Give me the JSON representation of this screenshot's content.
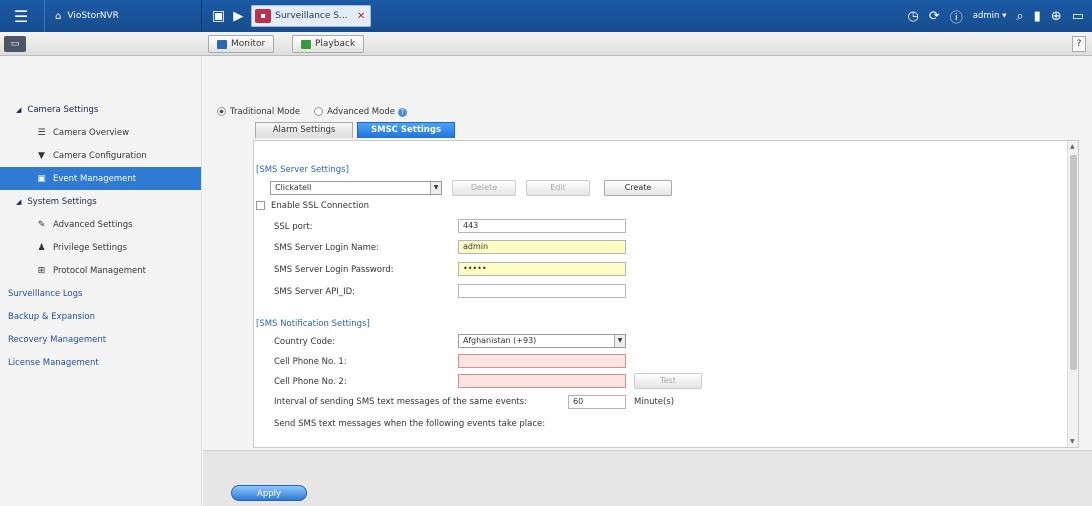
{
  "topbar": {
    "brand": "VioStorNVR",
    "app_tab": "Surveillance S...",
    "user": "admin"
  },
  "toolbar": {
    "monitor": "Monitor",
    "playback": "Playback",
    "help": "?"
  },
  "sidebar": {
    "camera_settings": "Camera Settings",
    "camera_overview": "Camera Overview",
    "camera_configuration": "Camera Configuration",
    "event_management": "Event Management",
    "system_settings": "System Settings",
    "advanced_settings": "Advanced Settings",
    "privilege_settings": "Privilege Settings",
    "protocol_management": "Protocol Management",
    "surveillance_logs": "Surveillance Logs",
    "backup_expansion": "Backup & Expansion",
    "recovery_management": "Recovery Management",
    "license_management": "License Management"
  },
  "modes": {
    "traditional": "Traditional Mode",
    "advanced": "Advanced Mode"
  },
  "tabs": {
    "alarm": "Alarm Settings",
    "smsc": "SMSC Settings"
  },
  "sms_server": {
    "section": "[SMS Server Settings]",
    "provider": "Clickatell",
    "delete": "Delete",
    "edit": "Edit",
    "create": "Create",
    "ssl_label": "Enable SSL Connection",
    "ssl_port_label": "SSL port:",
    "ssl_port": "443",
    "login_name_label": "SMS Server Login Name:",
    "login_name": "admin",
    "login_password_label": "SMS Server Login Password:",
    "login_password": "•••••",
    "api_id_label": "SMS Server API_ID:",
    "api_id": ""
  },
  "notification": {
    "section": "[SMS Notification Settings]",
    "country_label": "Country Code:",
    "country": "Afghanistan (+93)",
    "phone1_label": "Cell Phone No. 1:",
    "phone2_label": "Cell Phone No. 2:",
    "test": "Test",
    "interval_label": "Interval of sending SMS text messages of the same events:",
    "interval": "60",
    "interval_unit": "Minute(s)",
    "events_label": "Send SMS text messages when the following events take place:"
  },
  "footer": {
    "apply": "Apply"
  }
}
